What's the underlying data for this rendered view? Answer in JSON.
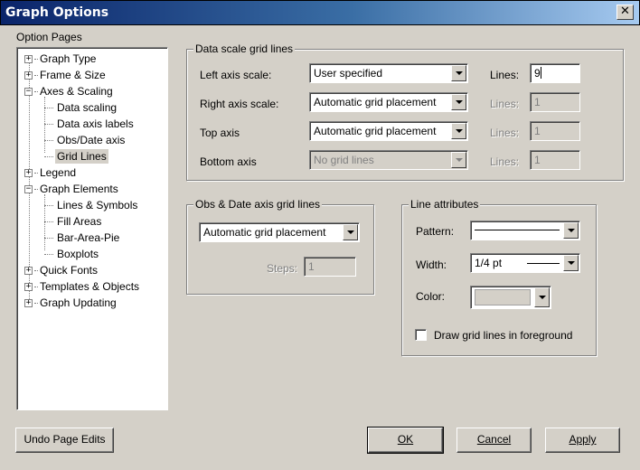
{
  "window": {
    "title": "Graph Options",
    "close_glyph": "✕"
  },
  "option_pages": {
    "label": "Option Pages",
    "items": [
      {
        "label": "Graph Type",
        "expander": "+"
      },
      {
        "label": "Frame & Size",
        "expander": "+"
      },
      {
        "label": "Axes & Scaling",
        "expander": "−"
      },
      {
        "label": "Data scaling"
      },
      {
        "label": "Data axis labels"
      },
      {
        "label": "Obs/Date axis"
      },
      {
        "label": "Grid Lines",
        "selected": true
      },
      {
        "label": "Legend",
        "expander": "+"
      },
      {
        "label": "Graph Elements",
        "expander": "−"
      },
      {
        "label": "Lines & Symbols"
      },
      {
        "label": "Fill Areas"
      },
      {
        "label": "Bar-Area-Pie"
      },
      {
        "label": "Boxplots"
      },
      {
        "label": "Quick Fonts",
        "expander": "+"
      },
      {
        "label": "Templates & Objects",
        "expander": "+"
      },
      {
        "label": "Graph Updating",
        "expander": "+"
      }
    ]
  },
  "data_scale": {
    "legend": "Data scale grid lines",
    "rows": [
      {
        "label": "Left axis scale:",
        "value": "User specified",
        "lines_label": "Lines:",
        "lines_value": "9",
        "enabled": true
      },
      {
        "label": "Right axis scale:",
        "value": "Automatic grid placement",
        "lines_label": "Lines:",
        "lines_value": "1",
        "enabled": false
      },
      {
        "label": "Top axis",
        "value": "Automatic grid placement",
        "lines_label": "Lines:",
        "lines_value": "1",
        "enabled": false
      },
      {
        "label": "Bottom axis",
        "value": "No grid lines",
        "lines_label": "Lines:",
        "lines_value": "1",
        "enabled": false
      }
    ]
  },
  "obs_date": {
    "legend": "Obs & Date axis grid lines",
    "placement": "Automatic grid placement",
    "steps_label": "Steps:",
    "steps_value": "1"
  },
  "line_attributes": {
    "legend": "Line attributes",
    "pattern_label": "Pattern:",
    "width_label": "Width:",
    "width_value": "1/4 pt",
    "color_label": "Color:",
    "color_value": "#d4d0c8",
    "foreground_label": "Draw grid lines in foreground",
    "foreground_checked": false
  },
  "buttons": {
    "undo": "Undo Page Edits",
    "ok": "OK",
    "cancel": "Cancel",
    "apply": "Apply"
  }
}
